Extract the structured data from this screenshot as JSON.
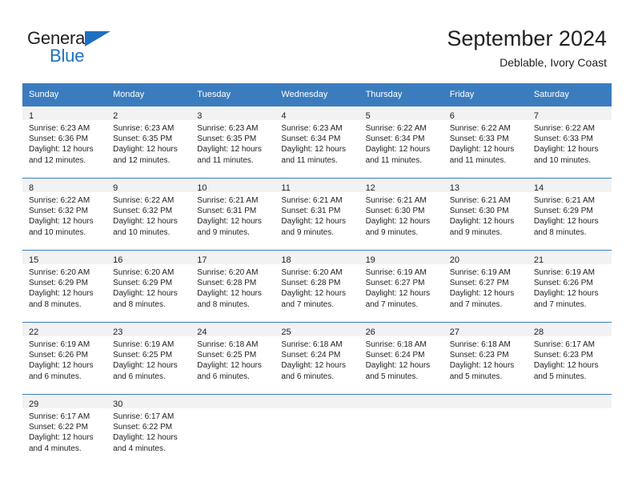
{
  "logo": {
    "word_top": "General",
    "word_bottom": "Blue",
    "triangle_color": "#1f6fc0",
    "text_color": "#231f20"
  },
  "header": {
    "title": "September 2024",
    "subtitle": "Deblable, Ivory Coast"
  },
  "theme": {
    "header_bg": "#3b7cbe",
    "header_text": "#ffffff",
    "daynum_band_bg": "#f2f2f2",
    "body_text": "#222222"
  },
  "calendar": {
    "weekdays": [
      "Sunday",
      "Monday",
      "Tuesday",
      "Wednesday",
      "Thursday",
      "Friday",
      "Saturday"
    ],
    "weeks": [
      [
        {
          "day": "1",
          "sunrise": "Sunrise: 6:23 AM",
          "sunset": "Sunset: 6:36 PM",
          "daylight1": "Daylight: 12 hours",
          "daylight2": "and 12 minutes."
        },
        {
          "day": "2",
          "sunrise": "Sunrise: 6:23 AM",
          "sunset": "Sunset: 6:35 PM",
          "daylight1": "Daylight: 12 hours",
          "daylight2": "and 12 minutes."
        },
        {
          "day": "3",
          "sunrise": "Sunrise: 6:23 AM",
          "sunset": "Sunset: 6:35 PM",
          "daylight1": "Daylight: 12 hours",
          "daylight2": "and 11 minutes."
        },
        {
          "day": "4",
          "sunrise": "Sunrise: 6:23 AM",
          "sunset": "Sunset: 6:34 PM",
          "daylight1": "Daylight: 12 hours",
          "daylight2": "and 11 minutes."
        },
        {
          "day": "5",
          "sunrise": "Sunrise: 6:22 AM",
          "sunset": "Sunset: 6:34 PM",
          "daylight1": "Daylight: 12 hours",
          "daylight2": "and 11 minutes."
        },
        {
          "day": "6",
          "sunrise": "Sunrise: 6:22 AM",
          "sunset": "Sunset: 6:33 PM",
          "daylight1": "Daylight: 12 hours",
          "daylight2": "and 11 minutes."
        },
        {
          "day": "7",
          "sunrise": "Sunrise: 6:22 AM",
          "sunset": "Sunset: 6:33 PM",
          "daylight1": "Daylight: 12 hours",
          "daylight2": "and 10 minutes."
        }
      ],
      [
        {
          "day": "8",
          "sunrise": "Sunrise: 6:22 AM",
          "sunset": "Sunset: 6:32 PM",
          "daylight1": "Daylight: 12 hours",
          "daylight2": "and 10 minutes."
        },
        {
          "day": "9",
          "sunrise": "Sunrise: 6:22 AM",
          "sunset": "Sunset: 6:32 PM",
          "daylight1": "Daylight: 12 hours",
          "daylight2": "and 10 minutes."
        },
        {
          "day": "10",
          "sunrise": "Sunrise: 6:21 AM",
          "sunset": "Sunset: 6:31 PM",
          "daylight1": "Daylight: 12 hours",
          "daylight2": "and 9 minutes."
        },
        {
          "day": "11",
          "sunrise": "Sunrise: 6:21 AM",
          "sunset": "Sunset: 6:31 PM",
          "daylight1": "Daylight: 12 hours",
          "daylight2": "and 9 minutes."
        },
        {
          "day": "12",
          "sunrise": "Sunrise: 6:21 AM",
          "sunset": "Sunset: 6:30 PM",
          "daylight1": "Daylight: 12 hours",
          "daylight2": "and 9 minutes."
        },
        {
          "day": "13",
          "sunrise": "Sunrise: 6:21 AM",
          "sunset": "Sunset: 6:30 PM",
          "daylight1": "Daylight: 12 hours",
          "daylight2": "and 9 minutes."
        },
        {
          "day": "14",
          "sunrise": "Sunrise: 6:21 AM",
          "sunset": "Sunset: 6:29 PM",
          "daylight1": "Daylight: 12 hours",
          "daylight2": "and 8 minutes."
        }
      ],
      [
        {
          "day": "15",
          "sunrise": "Sunrise: 6:20 AM",
          "sunset": "Sunset: 6:29 PM",
          "daylight1": "Daylight: 12 hours",
          "daylight2": "and 8 minutes."
        },
        {
          "day": "16",
          "sunrise": "Sunrise: 6:20 AM",
          "sunset": "Sunset: 6:29 PM",
          "daylight1": "Daylight: 12 hours",
          "daylight2": "and 8 minutes."
        },
        {
          "day": "17",
          "sunrise": "Sunrise: 6:20 AM",
          "sunset": "Sunset: 6:28 PM",
          "daylight1": "Daylight: 12 hours",
          "daylight2": "and 8 minutes."
        },
        {
          "day": "18",
          "sunrise": "Sunrise: 6:20 AM",
          "sunset": "Sunset: 6:28 PM",
          "daylight1": "Daylight: 12 hours",
          "daylight2": "and 7 minutes."
        },
        {
          "day": "19",
          "sunrise": "Sunrise: 6:19 AM",
          "sunset": "Sunset: 6:27 PM",
          "daylight1": "Daylight: 12 hours",
          "daylight2": "and 7 minutes."
        },
        {
          "day": "20",
          "sunrise": "Sunrise: 6:19 AM",
          "sunset": "Sunset: 6:27 PM",
          "daylight1": "Daylight: 12 hours",
          "daylight2": "and 7 minutes."
        },
        {
          "day": "21",
          "sunrise": "Sunrise: 6:19 AM",
          "sunset": "Sunset: 6:26 PM",
          "daylight1": "Daylight: 12 hours",
          "daylight2": "and 7 minutes."
        }
      ],
      [
        {
          "day": "22",
          "sunrise": "Sunrise: 6:19 AM",
          "sunset": "Sunset: 6:26 PM",
          "daylight1": "Daylight: 12 hours",
          "daylight2": "and 6 minutes."
        },
        {
          "day": "23",
          "sunrise": "Sunrise: 6:19 AM",
          "sunset": "Sunset: 6:25 PM",
          "daylight1": "Daylight: 12 hours",
          "daylight2": "and 6 minutes."
        },
        {
          "day": "24",
          "sunrise": "Sunrise: 6:18 AM",
          "sunset": "Sunset: 6:25 PM",
          "daylight1": "Daylight: 12 hours",
          "daylight2": "and 6 minutes."
        },
        {
          "day": "25",
          "sunrise": "Sunrise: 6:18 AM",
          "sunset": "Sunset: 6:24 PM",
          "daylight1": "Daylight: 12 hours",
          "daylight2": "and 6 minutes."
        },
        {
          "day": "26",
          "sunrise": "Sunrise: 6:18 AM",
          "sunset": "Sunset: 6:24 PM",
          "daylight1": "Daylight: 12 hours",
          "daylight2": "and 5 minutes."
        },
        {
          "day": "27",
          "sunrise": "Sunrise: 6:18 AM",
          "sunset": "Sunset: 6:23 PM",
          "daylight1": "Daylight: 12 hours",
          "daylight2": "and 5 minutes."
        },
        {
          "day": "28",
          "sunrise": "Sunrise: 6:17 AM",
          "sunset": "Sunset: 6:23 PM",
          "daylight1": "Daylight: 12 hours",
          "daylight2": "and 5 minutes."
        }
      ],
      [
        {
          "day": "29",
          "sunrise": "Sunrise: 6:17 AM",
          "sunset": "Sunset: 6:22 PM",
          "daylight1": "Daylight: 12 hours",
          "daylight2": "and 4 minutes."
        },
        {
          "day": "30",
          "sunrise": "Sunrise: 6:17 AM",
          "sunset": "Sunset: 6:22 PM",
          "daylight1": "Daylight: 12 hours",
          "daylight2": "and 4 minutes."
        },
        {
          "day": "",
          "sunrise": "",
          "sunset": "",
          "daylight1": "",
          "daylight2": ""
        },
        {
          "day": "",
          "sunrise": "",
          "sunset": "",
          "daylight1": "",
          "daylight2": ""
        },
        {
          "day": "",
          "sunrise": "",
          "sunset": "",
          "daylight1": "",
          "daylight2": ""
        },
        {
          "day": "",
          "sunrise": "",
          "sunset": "",
          "daylight1": "",
          "daylight2": ""
        },
        {
          "day": "",
          "sunrise": "",
          "sunset": "",
          "daylight1": "",
          "daylight2": ""
        }
      ]
    ]
  }
}
